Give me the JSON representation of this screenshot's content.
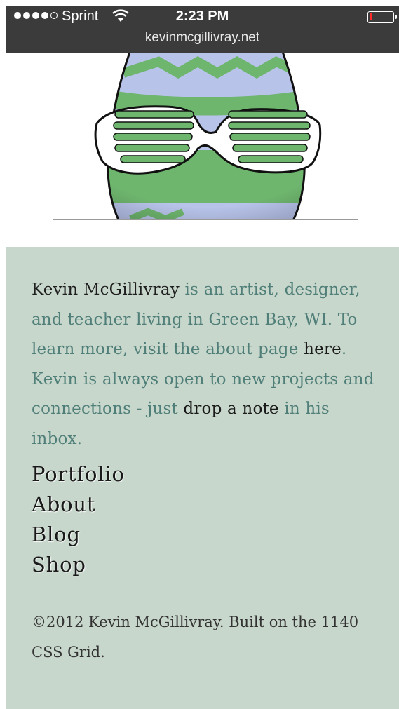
{
  "status_bar": {
    "carrier": "Sprint",
    "time": "2:23 PM",
    "url": "kevinmcgillivray.net",
    "signal_bars": 4,
    "signal_total": 5,
    "battery_level": 0.12,
    "battery_color": "#ff2a2a"
  },
  "bio": {
    "name": "Kevin McGillivray",
    "text1": " is an artist, designer, and teacher living in Green Bay, WI. To learn more, visit the about page ",
    "here_link": "here",
    "text2": ". Kevin is always open to new projects and connections - just ",
    "note_link": "drop a note",
    "text3": " in his inbox."
  },
  "nav": {
    "items": [
      "Portfolio",
      "About",
      "Blog",
      "Shop"
    ]
  },
  "footer": {
    "copyright": "©2012 Kevin McGillivray. Built on the 1140 CSS Grid."
  },
  "colors": {
    "section_bg": "#c8d7cc",
    "bio_text": "#4f7f78",
    "egg_green": "#6eb56e",
    "egg_blue": "#b8c3ea"
  }
}
